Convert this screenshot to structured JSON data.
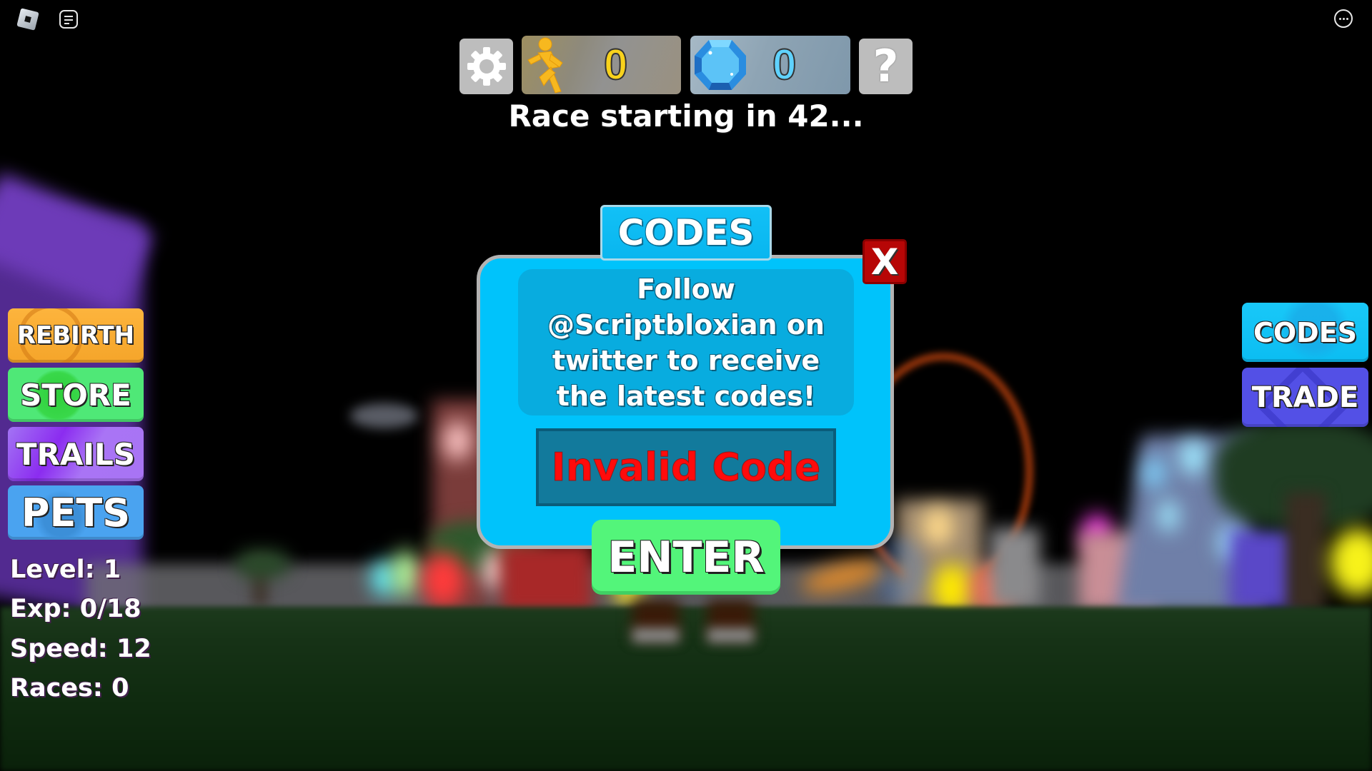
{
  "topbar": {
    "roblox_logo_icon": "roblox-logo-icon",
    "chat_icon": "chat-icon",
    "menu_icon": "more-options-icon"
  },
  "hud": {
    "settings_icon": "gear-icon",
    "speed_icon": "running-person-icon",
    "speed_value": "0",
    "gem_icon": "gem-icon",
    "gem_value": "0",
    "help_icon": "question-mark-icon",
    "help_label": "?",
    "race_status": "Race starting in 42..."
  },
  "left_menu": {
    "items": [
      {
        "label": "REBIRTH",
        "color": "#fdb43d"
      },
      {
        "label": "STORE",
        "color": "#4fe877"
      },
      {
        "label": "TRAILS",
        "color": "#a374f4"
      },
      {
        "label": "PETS",
        "color": "#4aa3f0"
      }
    ]
  },
  "stats": {
    "level": "Level: 1",
    "exp": "Exp: 0/18",
    "speed": "Speed: 12",
    "races": "Races: 0"
  },
  "right_menu": {
    "items": [
      {
        "label": "CODES",
        "color": "#19c8f8"
      },
      {
        "label": "TRADE",
        "color": "#5350e6"
      }
    ]
  },
  "codes_modal": {
    "title": "CODES",
    "close_label": "X",
    "info_lines": [
      "Follow",
      "@Scriptbloxian on",
      "twitter to receive",
      "the latest codes!"
    ],
    "input_value": "Invalid Code",
    "enter_label": "ENTER",
    "colors": {
      "panel": "#00c3fb",
      "close": "#b70606",
      "enter": "#53f57a",
      "error_text": "#ff0b0b"
    }
  }
}
